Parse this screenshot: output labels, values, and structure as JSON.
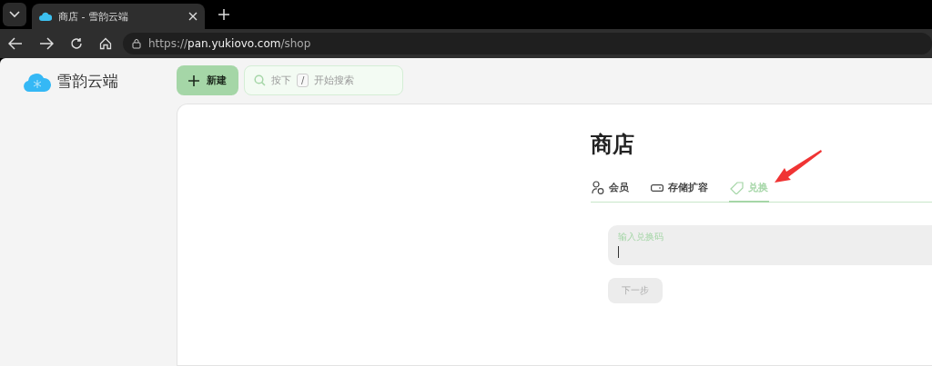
{
  "browser": {
    "tab_title": "商店 - 雪韵云端",
    "url": {
      "scheme": "https://",
      "host": "pan.yukiovo.com",
      "path": "/shop"
    }
  },
  "app": {
    "name": "雪韵云端",
    "new_button": "新建",
    "search": {
      "before": "按下",
      "key": "/",
      "after": "开始搜索"
    }
  },
  "page": {
    "title": "商店",
    "tabs": [
      {
        "label": "会员",
        "kind": "member",
        "selected": false
      },
      {
        "label": "存储扩容",
        "kind": "storage",
        "selected": false
      },
      {
        "label": "兑换",
        "kind": "redeem",
        "selected": true
      }
    ],
    "field": {
      "label": "输入兑换码",
      "focused": true
    },
    "next_button": {
      "label": "下一步",
      "disabled": true
    }
  }
}
